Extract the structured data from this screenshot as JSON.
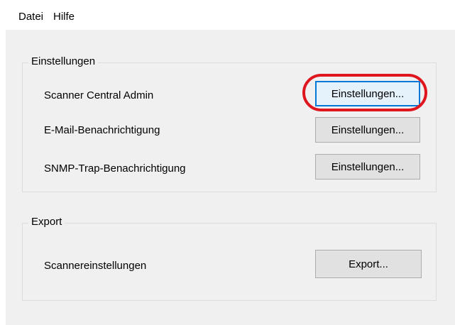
{
  "menu": {
    "items": [
      "Datei",
      "Hilfe"
    ]
  },
  "settings_group": {
    "title": "Einstellungen",
    "rows": [
      {
        "label": "Scanner Central Admin",
        "button": "Einstellungen...",
        "focused": true
      },
      {
        "label": "E-Mail-Benachrichtigung",
        "button": "Einstellungen..."
      },
      {
        "label": "SNMP-Trap-Benachrichtigung",
        "button": "Einstellungen..."
      }
    ]
  },
  "export_group": {
    "title": "Export",
    "rows": [
      {
        "label": "Scannereinstellungen",
        "button": "Export..."
      }
    ]
  },
  "colors": {
    "highlight": "#e0161e",
    "focus": "#0078d7",
    "dialog_bg": "#f0f0f0"
  }
}
